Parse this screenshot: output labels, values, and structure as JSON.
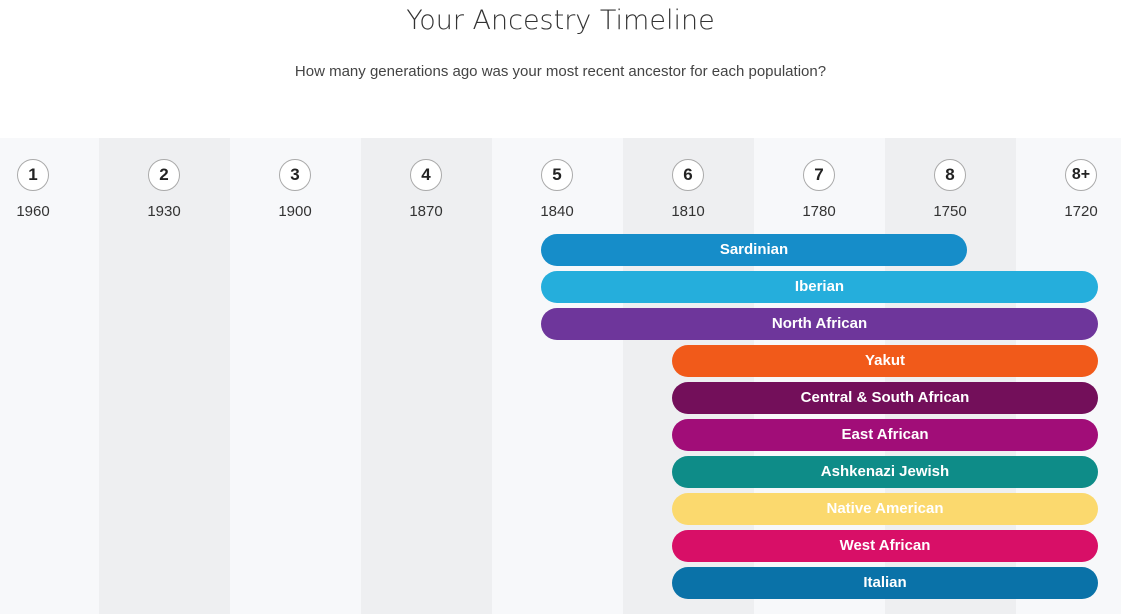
{
  "title": "Your Ancestry Timeline",
  "subtitle": "How many generations ago was your most recent ancestor for each population?",
  "chart_data": {
    "type": "timeline",
    "x_axis": {
      "generations": [
        "1",
        "2",
        "3",
        "4",
        "5",
        "6",
        "7",
        "8",
        "8+"
      ],
      "years": [
        "1960",
        "1930",
        "1900",
        "1870",
        "1840",
        "1810",
        "1780",
        "1750",
        "1720"
      ]
    },
    "bars": [
      {
        "name": "Sardinian",
        "start": "5",
        "end": "8",
        "color": "#168dc9",
        "text_color": "#ffffff"
      },
      {
        "name": "Iberian",
        "start": "5",
        "end": "8+",
        "color": "#25aedc",
        "text_color": "#ffffff"
      },
      {
        "name": "North African",
        "start": "5",
        "end": "8+",
        "color": "#6e369b",
        "text_color": "#ffffff"
      },
      {
        "name": "Yakut",
        "start": "6",
        "end": "8+",
        "color": "#f15a1a",
        "text_color": "#ffffff"
      },
      {
        "name": "Central & South African",
        "start": "6",
        "end": "8+",
        "color": "#730f5a",
        "text_color": "#ffffff"
      },
      {
        "name": "East African",
        "start": "6",
        "end": "8+",
        "color": "#a10d78",
        "text_color": "#ffffff"
      },
      {
        "name": "Ashkenazi Jewish",
        "start": "6",
        "end": "8+",
        "color": "#0e8c88",
        "text_color": "#ffffff"
      },
      {
        "name": "Native American",
        "start": "6",
        "end": "8+",
        "color": "#fbd96e",
        "text_color": "#ffffff"
      },
      {
        "name": "West African",
        "start": "6",
        "end": "8+",
        "color": "#d80f67",
        "text_color": "#ffffff"
      },
      {
        "name": "Italian",
        "start": "6",
        "end": "8+",
        "color": "#0a72a8",
        "text_color": "#ffffff"
      }
    ],
    "column_colors": [
      "#f7f8fa",
      "#eeeff1"
    ]
  }
}
